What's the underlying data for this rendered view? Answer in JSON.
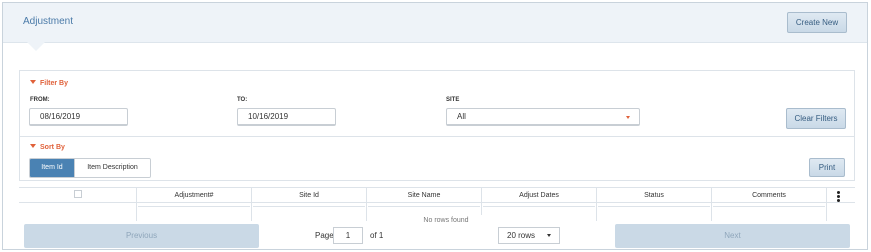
{
  "header": {
    "title": "Adjustment",
    "create_label": "Create New"
  },
  "filter": {
    "heading": "Filter By",
    "from_label": "FROM:",
    "from_value": "08/16/2019",
    "to_label": "TO:",
    "to_value": "10/16/2019",
    "site_label": "SITE",
    "site_value": "All",
    "clear_label": "Clear Filters"
  },
  "sort": {
    "heading": "Sort By",
    "options": [
      "Item Id",
      "Item Description"
    ],
    "selected": "Item Id",
    "print_label": "Print"
  },
  "grid": {
    "columns": [
      "Adjustment#",
      "Site Id",
      "Site Name",
      "Adjust Dates",
      "Status",
      "Comments"
    ],
    "empty_text": "No rows found"
  },
  "pager": {
    "previous_label": "Previous",
    "page_label": "Page",
    "page_value": "1",
    "of_label": "of 1",
    "rows_label": "20 rows",
    "next_label": "Next"
  },
  "colors": {
    "accent": "#4a82b3",
    "section_heading": "#e0613a",
    "header_bg": "#eef3f8"
  },
  "icons": [
    "triangle-down-icon",
    "chevron-down-icon",
    "kebab-menu-icon",
    "checkbox-icon"
  ]
}
